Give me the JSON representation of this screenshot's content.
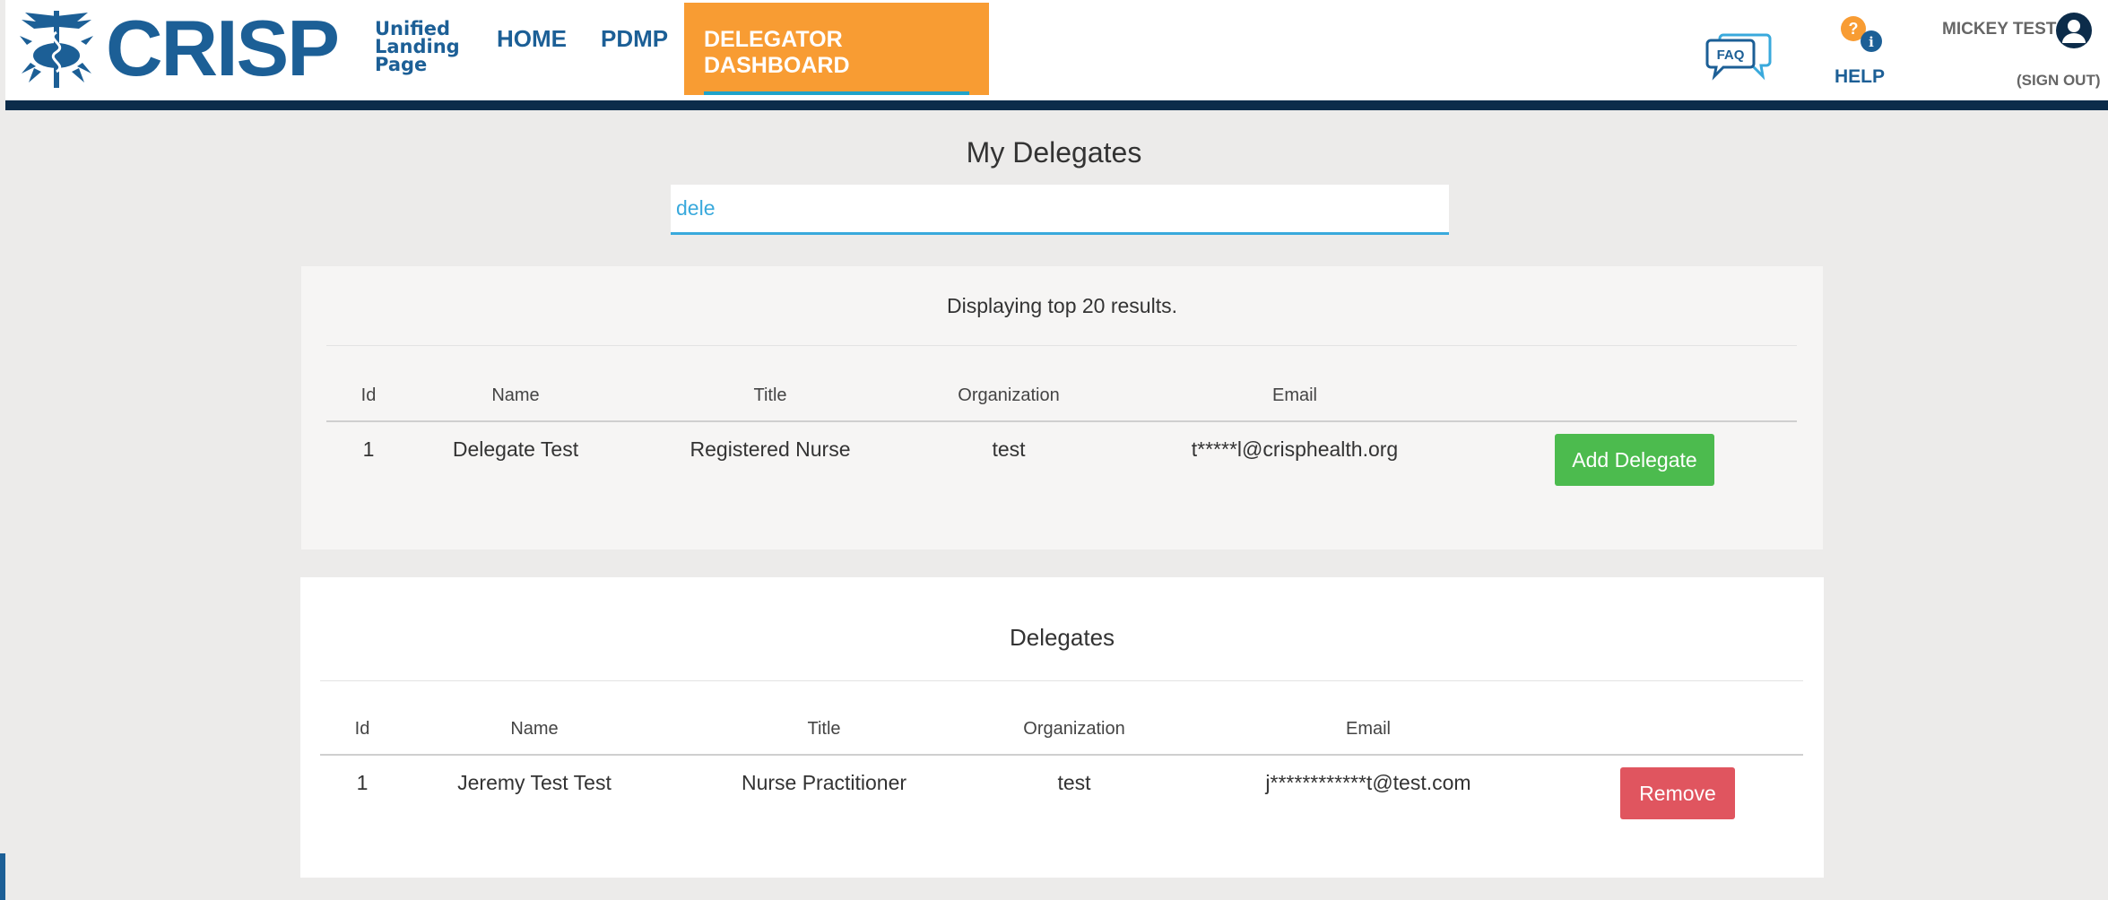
{
  "header": {
    "logo_text": "CRISP",
    "logo_sub": [
      "Unified",
      "Landing",
      "Page"
    ],
    "nav": {
      "home": "HOME",
      "pdmp": "PDMP",
      "active": "DELEGATOR DASHBOARD"
    },
    "faq_icon_text": "FAQ",
    "help_label": "HELP",
    "user_name": "MICKEY TEST",
    "sign_out": "(SIGN OUT)"
  },
  "main": {
    "title": "My Delegates",
    "search": {
      "value": "dele",
      "placeholder": ""
    }
  },
  "results": {
    "message": "Displaying top 20 results.",
    "columns": [
      "Id",
      "Name",
      "Title",
      "Organization",
      "Email"
    ],
    "rows": [
      {
        "id": "1",
        "name": "Delegate Test",
        "title": "Registered Nurse",
        "organization": "test",
        "email": "t*****l@crisphealth.org",
        "action": "Add Delegate"
      }
    ]
  },
  "delegates": {
    "heading": "Delegates",
    "columns": [
      "Id",
      "Name",
      "Title",
      "Organization",
      "Email"
    ],
    "rows": [
      {
        "id": "1",
        "name": "Jeremy Test Test",
        "title": "Nurse Practitioner",
        "organization": "test",
        "email": "j************t@test.com",
        "action": "Remove"
      }
    ]
  },
  "colors": {
    "brand_blue": "#1c5f96",
    "nav_active_bg": "#f89c33",
    "header_bar": "#0c2c4a",
    "add_button": "#4cbb4e",
    "remove_button": "#e0555f",
    "search_underline": "#39a9dc"
  }
}
